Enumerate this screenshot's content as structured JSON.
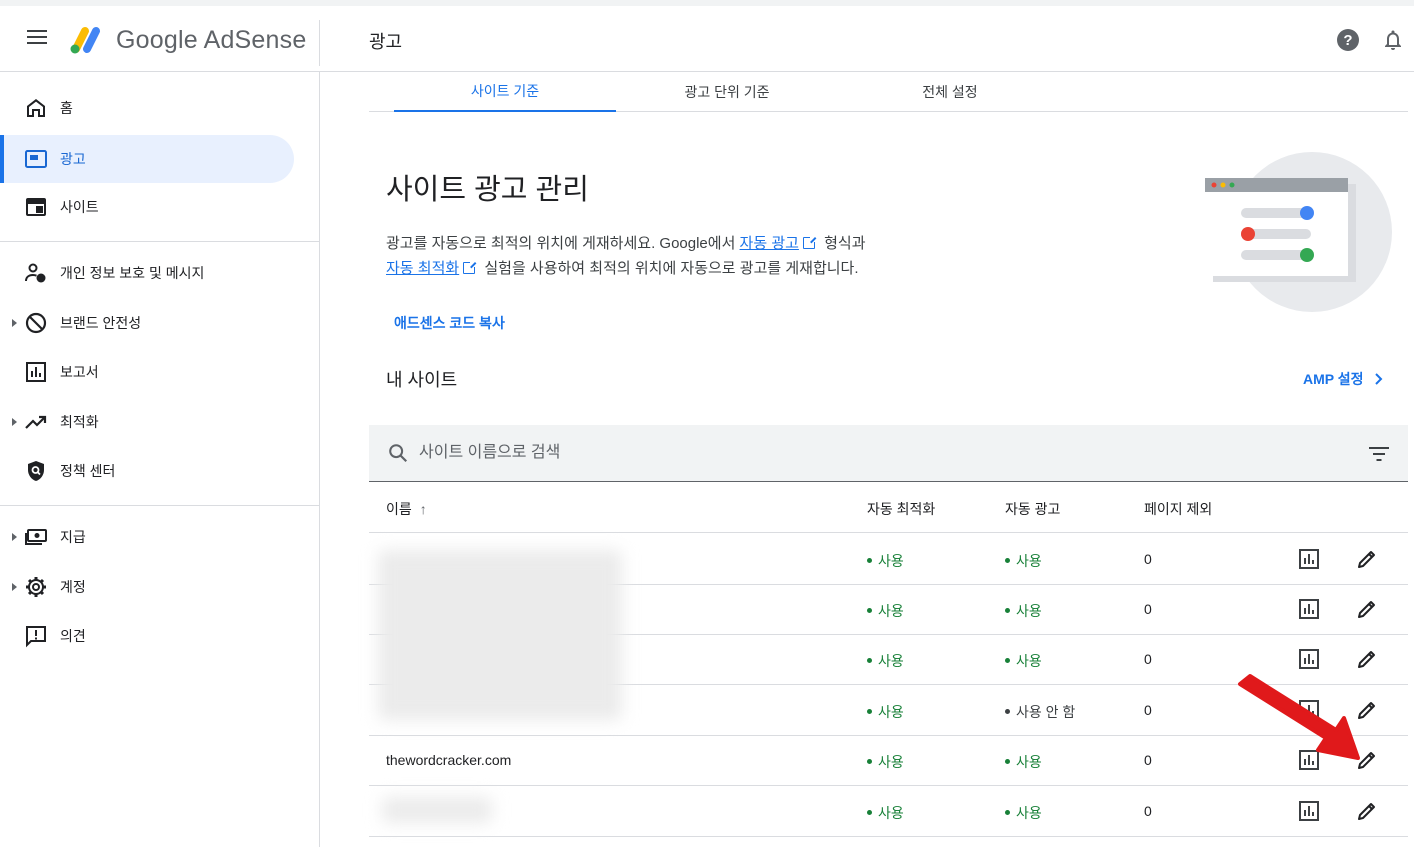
{
  "header": {
    "app_name": "Google AdSense",
    "page_title": "광고",
    "icons": [
      "menu-icon",
      "help-icon",
      "notifications-icon"
    ]
  },
  "sidebar": {
    "items": [
      {
        "label": "홈",
        "icon": "home-icon",
        "active": false,
        "expandable": false
      },
      {
        "label": "광고",
        "icon": "ads-icon",
        "active": true,
        "expandable": false
      },
      {
        "label": "사이트",
        "icon": "sites-icon",
        "active": false,
        "expandable": false
      },
      {
        "label": "개인 정보 보호 및 메시지",
        "icon": "privacy-messaging-icon",
        "active": false,
        "expandable": false
      },
      {
        "label": "브랜드 안전성",
        "icon": "block-icon",
        "active": false,
        "expandable": true
      },
      {
        "label": "보고서",
        "icon": "reports-icon",
        "active": false,
        "expandable": false
      },
      {
        "label": "최적화",
        "icon": "trending-up-icon",
        "active": false,
        "expandable": true
      },
      {
        "label": "정책 센터",
        "icon": "policy-shield-icon",
        "active": false,
        "expandable": false
      },
      {
        "label": "지급",
        "icon": "payments-icon",
        "active": false,
        "expandable": true
      },
      {
        "label": "계정",
        "icon": "settings-gear-icon",
        "active": false,
        "expandable": true
      },
      {
        "label": "의견",
        "icon": "feedback-icon",
        "active": false,
        "expandable": false
      }
    ]
  },
  "tabs": [
    {
      "label": "사이트 기준",
      "active": true
    },
    {
      "label": "광고 단위 기준",
      "active": false
    },
    {
      "label": "전체 설정",
      "active": false
    }
  ],
  "hero": {
    "title": "사이트 광고 관리",
    "desc_1": "광고를 자동으로 최적의 위치에 게재하세요. Google에서 ",
    "link_auto_ads": "자동 광고",
    "desc_2": " 형식과",
    "link_auto_opt": "자동 최적화",
    "desc_3": " 실험을 사용하여 최적의 위치에 자동으로 광고를 게재합니다.",
    "copy_code_label": "애드센스 코드 복사"
  },
  "sites_section": {
    "title": "내 사이트",
    "amp_label": "AMP 설정",
    "search_placeholder": "사이트 이름으로 검색"
  },
  "table": {
    "columns": [
      "이름",
      "자동 최적화",
      "자동 광고",
      "페이지 제외"
    ],
    "sort_indicator": "↑",
    "rows": [
      {
        "name": "",
        "auto_opt": "사용",
        "auto_ads": "사용",
        "auto_ads_on": true,
        "excluded": "0",
        "redacted": true
      },
      {
        "name": "",
        "auto_opt": "사용",
        "auto_ads": "사용",
        "auto_ads_on": true,
        "excluded": "0",
        "redacted": true
      },
      {
        "name": "",
        "auto_opt": "사용",
        "auto_ads": "사용",
        "auto_ads_on": true,
        "excluded": "0",
        "redacted": true
      },
      {
        "name": "",
        "auto_opt": "사용",
        "auto_ads": "사용 안 함",
        "auto_ads_on": false,
        "excluded": "0",
        "redacted": true
      },
      {
        "name": "thewordcracker.com",
        "auto_opt": "사용",
        "auto_ads": "사용",
        "auto_ads_on": true,
        "excluded": "0",
        "redacted": false
      },
      {
        "name": "",
        "auto_opt": "사용",
        "auto_ads": "사용",
        "auto_ads_on": true,
        "excluded": "0",
        "redacted": true
      }
    ]
  },
  "colors": {
    "accent": "#1a73e8",
    "active_bg": "#e8f0fe",
    "status_on": "#188038",
    "annotation_arrow": "#e0191b"
  }
}
